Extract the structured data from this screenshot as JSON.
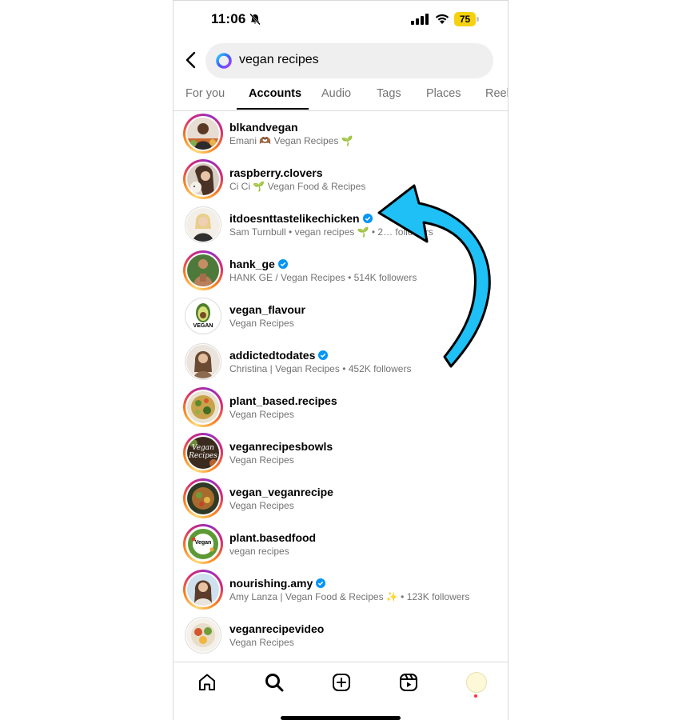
{
  "status_bar": {
    "time": "11:06",
    "battery": "75"
  },
  "search": {
    "query": "vegan recipes"
  },
  "tabs": [
    {
      "label": "For you"
    },
    {
      "label": "Accounts"
    },
    {
      "label": "Audio"
    },
    {
      "label": "Tags"
    },
    {
      "label": "Places"
    },
    {
      "label": "Reel"
    }
  ],
  "accounts": [
    {
      "username": "blkandvegan",
      "subtitle": "Emani 🫶🏾 Vegan Recipes 🌱",
      "verified": false,
      "ring": true
    },
    {
      "username": "raspberry.clovers",
      "subtitle": "Ci Ci  🌱 Vegan Food & Recipes",
      "verified": false,
      "ring": true
    },
    {
      "username": "itdoesnttastelikechicken",
      "subtitle": "Sam Turnbull • vegan recipes 🌱 • 2… followers",
      "verified": true,
      "ring": false
    },
    {
      "username": "hank_ge",
      "subtitle": "HANK GE / Vegan Recipes • 514K followers",
      "verified": true,
      "ring": true
    },
    {
      "username": "vegan_flavour",
      "subtitle": "Vegan Recipes",
      "verified": false,
      "ring": false
    },
    {
      "username": "addictedtodates",
      "subtitle": "Christina | Vegan Recipes • 452K followers",
      "verified": true,
      "ring": false
    },
    {
      "username": "plant_based.recipes",
      "subtitle": "Vegan Recipes",
      "verified": false,
      "ring": true
    },
    {
      "username": "veganrecipesbowls",
      "subtitle": "Vegan Recipes",
      "verified": false,
      "ring": true
    },
    {
      "username": "vegan_veganrecipe",
      "subtitle": "Vegan Recipes",
      "verified": false,
      "ring": true
    },
    {
      "username": "plant.basedfood",
      "subtitle": "vegan recipes",
      "verified": false,
      "ring": true
    },
    {
      "username": "nourishing.amy",
      "subtitle": "Amy Lanza | Vegan Food & Recipes ✨ • 123K followers",
      "verified": true,
      "ring": true
    },
    {
      "username": "veganrecipevideo",
      "subtitle": "Vegan Recipes",
      "verified": false,
      "ring": false
    }
  ],
  "avatar_logo_text": {
    "vegan_flavour": "VEGAN",
    "veganrecipesbowls": "Vegan Recipes",
    "plant_basedfood": "Vegan"
  },
  "colors": {
    "accent_arrow": "#1ec0f5",
    "verified_blue": "#0095f6",
    "tab_active": "#000000",
    "notification_dot": "#ff3040"
  },
  "icons": {
    "nav": [
      "home-icon",
      "search-icon",
      "create-icon",
      "reels-icon",
      "profile-avatar"
    ]
  }
}
